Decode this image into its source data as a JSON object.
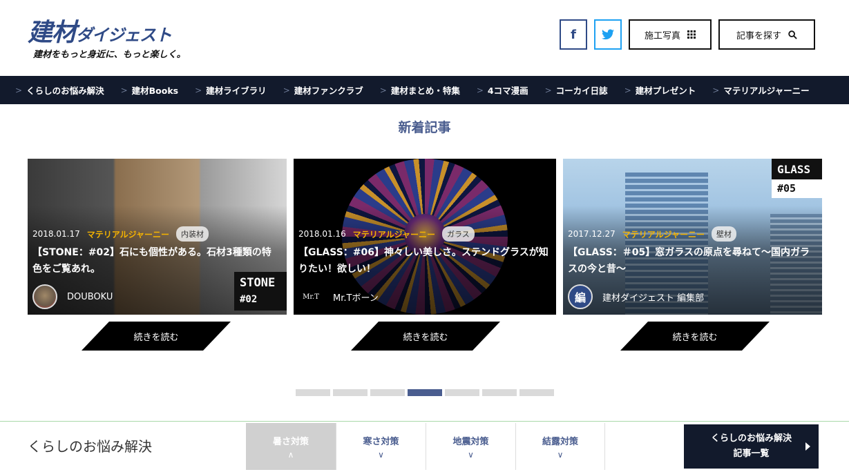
{
  "header": {
    "logo_main": "建材",
    "logo_small": "ダイジェスト",
    "tagline": "建材をもっと身近に、もっと楽しく。",
    "facebook_icon": "f",
    "photo_label": "施工写真",
    "search_label": "記事を探す"
  },
  "nav": {
    "chevron": ">",
    "items": [
      "くらしのお悩み解決",
      "建材Books",
      "建材ライブラリ",
      "建材ファンクラブ",
      "建材まとめ・特集",
      "4コマ漫画",
      "コーカイ日誌",
      "建材プレゼント",
      "マテリアルジャーニー"
    ]
  },
  "section": {
    "title": "新着記事"
  },
  "cards": [
    {
      "date": "2018.01.17",
      "category": "マテリアルジャーニー",
      "tag": "内装材",
      "title": "【STONE：#02】石にも個性がある。石材3種類の特色をご覧あれ。",
      "author": "DOUBOKU",
      "badge_line1": "STONE",
      "badge_line2": "#02",
      "read_label": "続きを読む"
    },
    {
      "date": "2018.01.16",
      "category": "マテリアルジャーニー",
      "tag": "ガラス",
      "title": "【GLASS：#06】神々しい美しさ。ステンドグラスが知りたい！欲しい！",
      "author": "Mr.Tボーン",
      "avatar_text": "Mr.T",
      "read_label": "続きを読む"
    },
    {
      "date": "2017.12.27",
      "category": "マテリアルジャーニー",
      "tag": "壁材",
      "title": "【GLASS：＃05】窓ガラスの原点を尋ねて〜国内ガラスの今と昔〜",
      "author": "建材ダイジェスト 編集部",
      "avatar_text": "編",
      "badge_line1": "GLASS",
      "badge_line2": "#05",
      "read_label": "続きを読む"
    }
  ],
  "pager": {
    "count": 7,
    "active_index": 3
  },
  "bottom": {
    "title": "くらしのお悩み解決",
    "tabs": [
      {
        "label": "暑さ対策",
        "arrow": "∧"
      },
      {
        "label": "寒さ対策",
        "arrow": "∨"
      },
      {
        "label": "地震対策",
        "arrow": "∨"
      },
      {
        "label": "結露対策",
        "arrow": "∨"
      }
    ],
    "all_line1": "くらしのお悩み解決",
    "all_line2": "記事一覧"
  },
  "colors": {
    "brand": "#2f4a86",
    "nav_bg": "#121a2c",
    "category": "#f5b400",
    "twitter": "#1da1f2"
  }
}
